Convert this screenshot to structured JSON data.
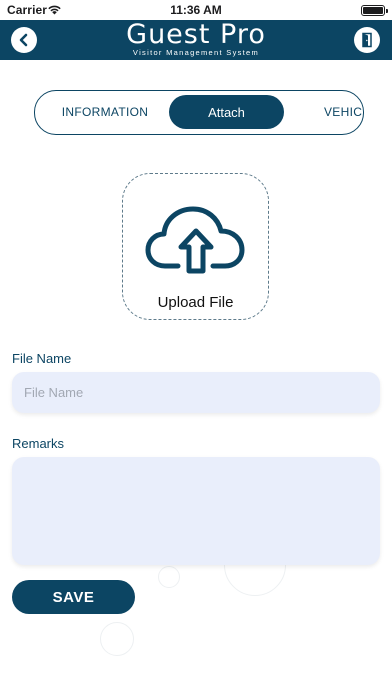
{
  "status_bar": {
    "carrier": "Carrier",
    "time": "11:36 AM"
  },
  "header": {
    "title": "Guest Pro",
    "subtitle": "Visitor Management System",
    "back_icon": "chevron-left-icon",
    "exit_icon": "door-exit-icon"
  },
  "tabs": [
    {
      "label": "INFORMATION",
      "selected": false
    },
    {
      "label": "Attach",
      "selected": true
    },
    {
      "label": "VEHIC",
      "selected": false
    }
  ],
  "upload": {
    "label": "Upload File",
    "icon": "cloud-upload-icon"
  },
  "form": {
    "file_name": {
      "label": "File Name",
      "placeholder": "File Name",
      "value": ""
    },
    "remarks": {
      "label": "Remarks",
      "placeholder": "",
      "value": ""
    },
    "save_label": "SAVE"
  },
  "colors": {
    "primary": "#0c4563",
    "input_bg": "#e9eefb",
    "background": "#ffffff"
  }
}
